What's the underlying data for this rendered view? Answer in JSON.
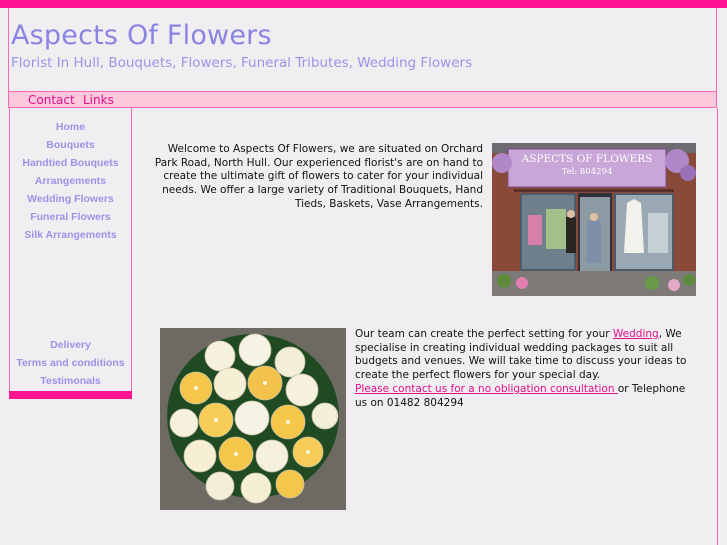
{
  "header": {
    "title": "Aspects Of Flowers",
    "subtitle": "Florist In Hull, Bouquets, Flowers, Funeral Tributes, Wedding Flowers"
  },
  "topnav": {
    "items": [
      {
        "label": "Contact"
      },
      {
        "label": "Links"
      }
    ]
  },
  "sidebar": {
    "items": [
      {
        "label": "Home"
      },
      {
        "label": "Bouquets"
      },
      {
        "label": "Handtied Bouquets"
      },
      {
        "label": "Arrangements"
      },
      {
        "label": "Wedding Flowers"
      },
      {
        "label": "Funeral Flowers"
      },
      {
        "label": "Silk Arrangements"
      }
    ],
    "lower_items": [
      {
        "label": "Delivery"
      },
      {
        "label": "Terms and conditions"
      },
      {
        "label": "Testimonals"
      }
    ]
  },
  "intro": {
    "text": "Welcome to Aspects Of Flowers, we are situated on Orchard Park Road, North Hull. Our experienced florist's are on hand to create the ultimate gift of flowers to cater for your individual needs. We offer a large variety of Traditional Bouquets, Hand Tieds, Baskets, Vase Arrangements."
  },
  "shop_photo": {
    "sign_text": "ASPECTS OF FLOWERS",
    "sign_tel": "Tel: 804294"
  },
  "wedding": {
    "text_before": "Our team can create the perfect setting for your ",
    "link_label": "Wedding",
    "text_after": ", We specialise in creating individual wedding packages to suit all budgets and venues. We will take time to discuss your ideas to create the perfect flowers for your special day.",
    "contact_link_label": "Please contact us for a no obligation consultation ",
    "contact_text_after": "or Telephone us on 01482 804294"
  },
  "colors": {
    "accent": "#ff1493",
    "title": "#8a84e3",
    "link": "#e0108a",
    "background": "#f1eef1"
  }
}
